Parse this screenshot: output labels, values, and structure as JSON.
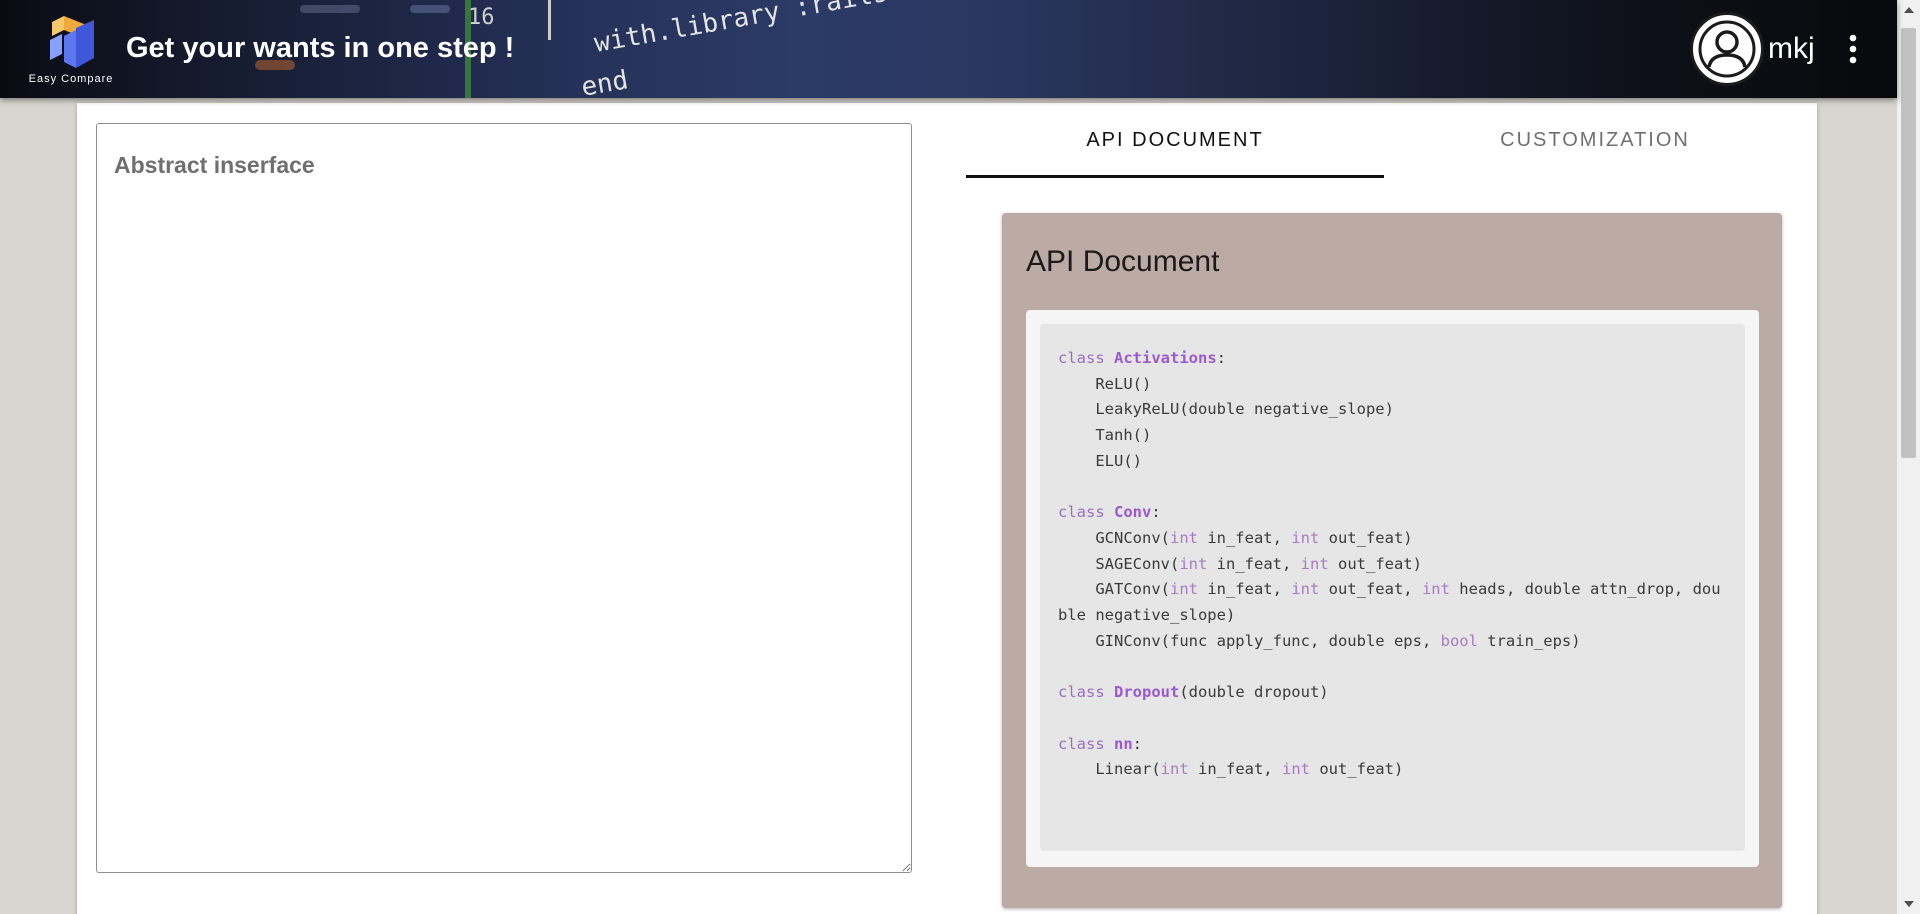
{
  "header": {
    "logo_text": "Easy Compare",
    "title": "Get your wants in one step !",
    "username": "mkj",
    "background_hint_text": [
      "with.library :rails",
      "end",
      "16"
    ]
  },
  "editor": {
    "placeholder": "Abstract inserface"
  },
  "tabs": [
    {
      "label": "API DOCUMENT",
      "active": true
    },
    {
      "label": "CUSTOMIZATION",
      "active": false
    }
  ],
  "api_panel": {
    "heading": "API Document",
    "code": [
      [
        {
          "t": "class ",
          "c": "kw"
        },
        {
          "t": "Activations",
          "c": "cls"
        },
        {
          "t": ":",
          "c": ""
        }
      ],
      [
        {
          "t": "    ReLU()",
          "c": ""
        }
      ],
      [
        {
          "t": "    LeakyReLU(double negative_slope)",
          "c": ""
        }
      ],
      [
        {
          "t": "    Tanh()",
          "c": ""
        }
      ],
      [
        {
          "t": "    ELU()",
          "c": ""
        }
      ],
      [
        {
          "t": "",
          "c": ""
        }
      ],
      [
        {
          "t": "class ",
          "c": "kw"
        },
        {
          "t": "Conv",
          "c": "cls"
        },
        {
          "t": ":",
          "c": ""
        }
      ],
      [
        {
          "t": "    GCNConv(",
          "c": ""
        },
        {
          "t": "int",
          "c": "type"
        },
        {
          "t": " in_feat, ",
          "c": ""
        },
        {
          "t": "int",
          "c": "type"
        },
        {
          "t": " out_feat)",
          "c": ""
        }
      ],
      [
        {
          "t": "    SAGEConv(",
          "c": ""
        },
        {
          "t": "int",
          "c": "type"
        },
        {
          "t": " in_feat, ",
          "c": ""
        },
        {
          "t": "int",
          "c": "type"
        },
        {
          "t": " out_feat)",
          "c": ""
        }
      ],
      [
        {
          "t": "    GATConv(",
          "c": ""
        },
        {
          "t": "int",
          "c": "type"
        },
        {
          "t": " in_feat, ",
          "c": ""
        },
        {
          "t": "int",
          "c": "type"
        },
        {
          "t": " out_feat, ",
          "c": ""
        },
        {
          "t": "int",
          "c": "type"
        },
        {
          "t": " heads, double attn_drop, double negative_slope)",
          "c": ""
        }
      ],
      [
        {
          "t": "    GINConv(func apply_func, double eps, ",
          "c": ""
        },
        {
          "t": "bool",
          "c": "type"
        },
        {
          "t": " train_eps)",
          "c": ""
        }
      ],
      [
        {
          "t": "",
          "c": ""
        }
      ],
      [
        {
          "t": "class ",
          "c": "kw"
        },
        {
          "t": "Dropout",
          "c": "cls"
        },
        {
          "t": "(double dropout)",
          "c": ""
        }
      ],
      [
        {
          "t": "",
          "c": ""
        }
      ],
      [
        {
          "t": "class ",
          "c": "kw"
        },
        {
          "t": "nn",
          "c": "cls"
        },
        {
          "t": ":",
          "c": ""
        }
      ],
      [
        {
          "t": "    Linear(",
          "c": ""
        },
        {
          "t": "int",
          "c": "type"
        },
        {
          "t": " in_feat, ",
          "c": ""
        },
        {
          "t": "int",
          "c": "type"
        },
        {
          "t": " out_feat)",
          "c": ""
        }
      ]
    ]
  },
  "icons": {
    "logo": "app-logo-icon",
    "avatar": "user-avatar-icon",
    "more": "more-vertical-icon"
  },
  "colors": {
    "panel_bg": "#bcaaa4",
    "code_bg": "#e6e6e6",
    "keyword": "#9b6fc0",
    "class_name": "#9b59d0",
    "tab_active": "#111111",
    "tab_inactive": "#707070"
  }
}
